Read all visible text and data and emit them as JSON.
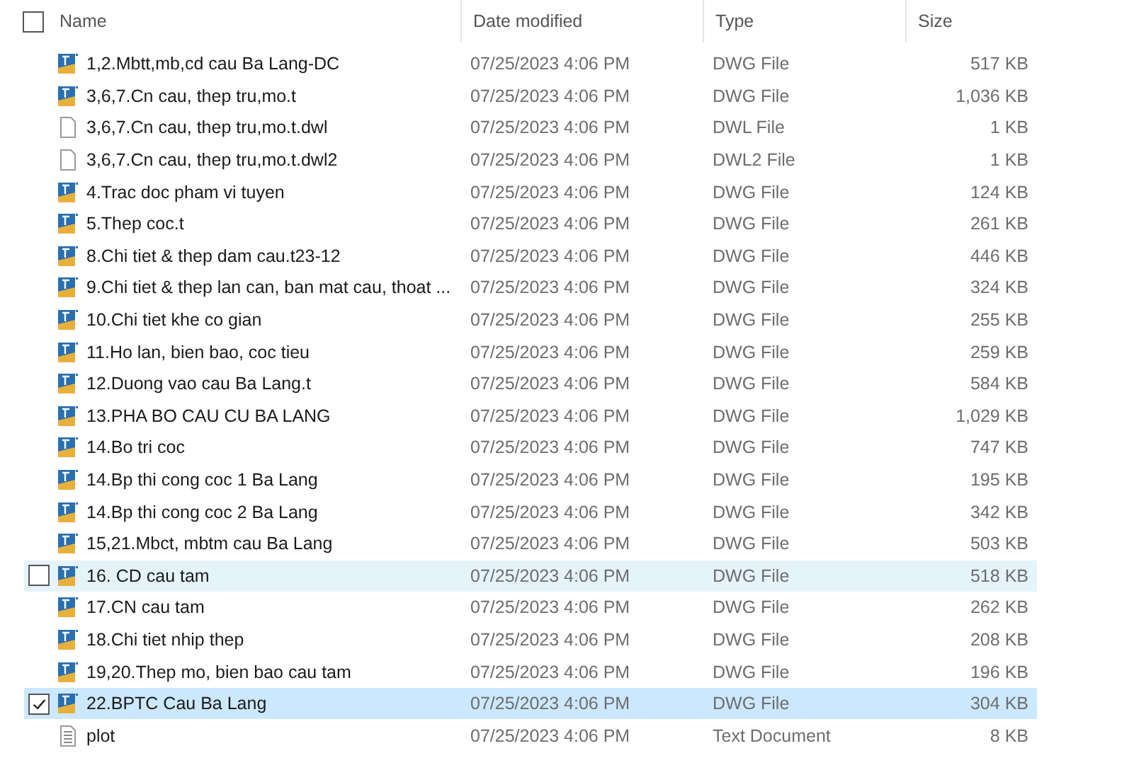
{
  "select_all": {
    "checked": false
  },
  "columns": [
    {
      "label": "Name"
    },
    {
      "label": "Date modified"
    },
    {
      "label": "Type"
    },
    {
      "label": "Size"
    }
  ],
  "rows": [
    {
      "kind": "dwg",
      "name": "1,2.Mbtt,mb,cd cau Ba Lang-DC",
      "date": "07/25/2023 4:06 PM",
      "type": "DWG File",
      "size": "517 KB",
      "hovered": false,
      "selected": false
    },
    {
      "kind": "dwg",
      "name": "3,6,7.Cn cau, thep tru,mo.t",
      "date": "07/25/2023 4:06 PM",
      "type": "DWG File",
      "size": "1,036 KB",
      "hovered": false,
      "selected": false
    },
    {
      "kind": "blank",
      "name": "3,6,7.Cn cau, thep tru,mo.t.dwl",
      "date": "07/25/2023 4:06 PM",
      "type": "DWL File",
      "size": "1 KB",
      "hovered": false,
      "selected": false
    },
    {
      "kind": "blank",
      "name": "3,6,7.Cn cau, thep tru,mo.t.dwl2",
      "date": "07/25/2023 4:06 PM",
      "type": "DWL2 File",
      "size": "1 KB",
      "hovered": false,
      "selected": false
    },
    {
      "kind": "dwg",
      "name": "4.Trac doc pham vi tuyen",
      "date": "07/25/2023 4:06 PM",
      "type": "DWG File",
      "size": "124 KB",
      "hovered": false,
      "selected": false
    },
    {
      "kind": "dwg",
      "name": "5.Thep coc.t",
      "date": "07/25/2023 4:06 PM",
      "type": "DWG File",
      "size": "261 KB",
      "hovered": false,
      "selected": false
    },
    {
      "kind": "dwg",
      "name": "8.Chi tiet & thep dam cau.t23-12",
      "date": "07/25/2023 4:06 PM",
      "type": "DWG File",
      "size": "446 KB",
      "hovered": false,
      "selected": false
    },
    {
      "kind": "dwg",
      "name": "9.Chi tiet & thep lan can, ban mat cau, thoat ...",
      "date": "07/25/2023 4:06 PM",
      "type": "DWG File",
      "size": "324 KB",
      "hovered": false,
      "selected": false
    },
    {
      "kind": "dwg",
      "name": "10.Chi tiet khe co gian",
      "date": "07/25/2023 4:06 PM",
      "type": "DWG File",
      "size": "255 KB",
      "hovered": false,
      "selected": false
    },
    {
      "kind": "dwg",
      "name": "11.Ho lan, bien bao, coc tieu",
      "date": "07/25/2023 4:06 PM",
      "type": "DWG File",
      "size": "259 KB",
      "hovered": false,
      "selected": false
    },
    {
      "kind": "dwg",
      "name": "12.Duong vao cau Ba Lang.t",
      "date": "07/25/2023 4:06 PM",
      "type": "DWG File",
      "size": "584 KB",
      "hovered": false,
      "selected": false
    },
    {
      "kind": "dwg",
      "name": "13.PHA BO CAU CU BA LANG",
      "date": "07/25/2023 4:06 PM",
      "type": "DWG File",
      "size": "1,029 KB",
      "hovered": false,
      "selected": false
    },
    {
      "kind": "dwg",
      "name": "14.Bo tri coc",
      "date": "07/25/2023 4:06 PM",
      "type": "DWG File",
      "size": "747 KB",
      "hovered": false,
      "selected": false
    },
    {
      "kind": "dwg",
      "name": "14.Bp thi cong coc 1 Ba Lang",
      "date": "07/25/2023 4:06 PM",
      "type": "DWG File",
      "size": "195 KB",
      "hovered": false,
      "selected": false
    },
    {
      "kind": "dwg",
      "name": "14.Bp thi cong coc 2 Ba Lang",
      "date": "07/25/2023 4:06 PM",
      "type": "DWG File",
      "size": "342 KB",
      "hovered": false,
      "selected": false
    },
    {
      "kind": "dwg",
      "name": "15,21.Mbct, mbtm cau Ba Lang",
      "date": "07/25/2023 4:06 PM",
      "type": "DWG File",
      "size": "503 KB",
      "hovered": false,
      "selected": false
    },
    {
      "kind": "dwg",
      "name": "16. CD cau tam",
      "date": "07/25/2023 4:06 PM",
      "type": "DWG File",
      "size": "518 KB",
      "hovered": true,
      "selected": false
    },
    {
      "kind": "dwg",
      "name": "17.CN cau tam",
      "date": "07/25/2023 4:06 PM",
      "type": "DWG File",
      "size": "262 KB",
      "hovered": false,
      "selected": false
    },
    {
      "kind": "dwg",
      "name": "18.Chi tiet nhip thep",
      "date": "07/25/2023 4:06 PM",
      "type": "DWG File",
      "size": "208 KB",
      "hovered": false,
      "selected": false
    },
    {
      "kind": "dwg",
      "name": "19,20.Thep mo, bien bao cau tam",
      "date": "07/25/2023 4:06 PM",
      "type": "DWG File",
      "size": "196 KB",
      "hovered": false,
      "selected": false
    },
    {
      "kind": "dwg",
      "name": "22.BPTC Cau Ba Lang",
      "date": "07/25/2023 4:06 PM",
      "type": "DWG File",
      "size": "304 KB",
      "hovered": false,
      "selected": true
    },
    {
      "kind": "text",
      "name": "plot",
      "date": "07/25/2023 4:06 PM",
      "type": "Text Document",
      "size": "8 KB",
      "hovered": false,
      "selected": false
    }
  ]
}
